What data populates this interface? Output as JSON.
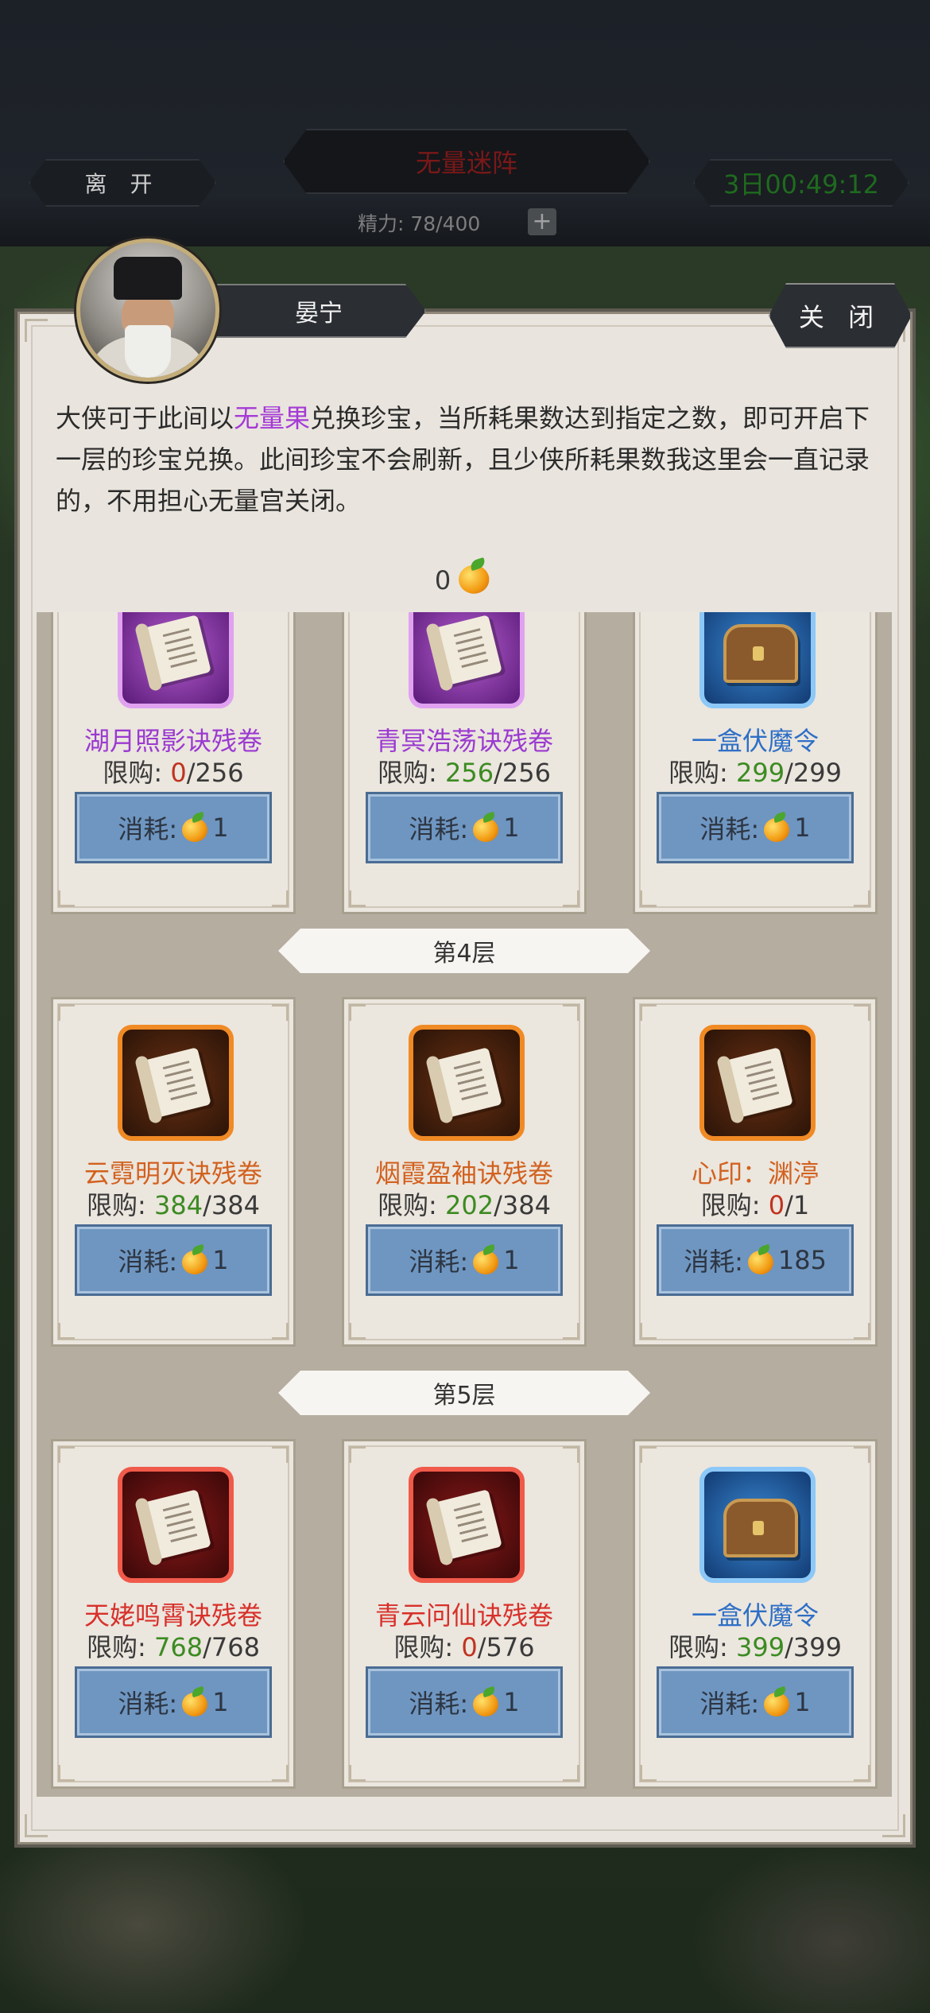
{
  "header": {
    "leave_label": "离 开",
    "title": "无量迷阵",
    "timer": "3日00:49:12",
    "energy_text": "精力: 78/400",
    "plus_label": "+"
  },
  "dialog": {
    "npc_name": "晏宁",
    "close_label": "关 闭",
    "desc_part1": "大侠可于此间以",
    "desc_highlight": "无量果",
    "desc_part2": "兑换珍宝，当所耗果数达到指定之数，即可开启下一层的珍宝兑换。此间珍宝不会刷新，且少侠所耗果数我这里会一直记录的，不用担心无量宫关闭。",
    "balance": "0"
  },
  "shop": {
    "limit_prefix": "限购: ",
    "cost_prefix": "消耗: ",
    "rows": [
      {
        "items": [
          {
            "name": "湖月照影诀残卷",
            "color": "#9b3ad0",
            "icon": "scroll-icon",
            "rarity": "purple",
            "current": "0",
            "cur_color": "red",
            "max": "/256",
            "cost": "1"
          },
          {
            "name": "青冥浩荡诀残卷",
            "color": "#9b3ad0",
            "icon": "scroll-icon",
            "rarity": "purple",
            "current": "256",
            "cur_color": "green",
            "max": "/256",
            "cost": "1"
          },
          {
            "name": "一盒伏魔令",
            "color": "#2e6fc6",
            "icon": "chest-icon",
            "rarity": "blue",
            "current": "299",
            "cur_color": "green",
            "max": "/299",
            "cost": "1"
          }
        ]
      },
      {
        "floor": "第4层",
        "items": [
          {
            "name": "云霓明灭诀残卷",
            "color": "#d2611f",
            "icon": "scroll-icon",
            "rarity": "orange",
            "current": "384",
            "cur_color": "green",
            "max": "/384",
            "cost": "1"
          },
          {
            "name": "烟霞盈袖诀残卷",
            "color": "#d2611f",
            "icon": "scroll-icon",
            "rarity": "orange",
            "current": "202",
            "cur_color": "green",
            "max": "/384",
            "cost": "1"
          },
          {
            "name": "心印：渊渟",
            "color": "#d2611f",
            "icon": "scroll-icon",
            "rarity": "orange",
            "current": "0",
            "cur_color": "red",
            "max": "/1",
            "cost": "185"
          }
        ]
      },
      {
        "floor": "第5层",
        "items": [
          {
            "name": "天姥鸣霄诀残卷",
            "color": "#d8302a",
            "icon": "scroll-icon",
            "rarity": "red",
            "current": "768",
            "cur_color": "green",
            "max": "/768",
            "cost": "1"
          },
          {
            "name": "青云问仙诀残卷",
            "color": "#d8302a",
            "icon": "scroll-icon",
            "rarity": "red",
            "current": "0",
            "cur_color": "red",
            "max": "/576",
            "cost": "1"
          },
          {
            "name": "一盒伏魔令",
            "color": "#2e6fc6",
            "icon": "chest-icon",
            "rarity": "blue",
            "current": "399",
            "cur_color": "green",
            "max": "/399",
            "cost": "1"
          }
        ]
      }
    ]
  },
  "icons": {
    "currency": "fruit-icon"
  }
}
